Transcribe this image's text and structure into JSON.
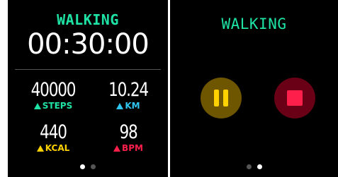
{
  "stats_screen": {
    "activity": "WALKING",
    "timer": "00:30:00",
    "stats": [
      {
        "value": "40000",
        "unit": "STEPS",
        "color": "#1fe3a5"
      },
      {
        "value": "10.24",
        "unit": "KM",
        "color": "#2ec5f0"
      },
      {
        "value": "440",
        "unit": "KCAL",
        "color": "#ffd200"
      },
      {
        "value": "98",
        "unit": "BPM",
        "color": "#ff1f4b"
      }
    ],
    "page_indicator": {
      "pages": 2,
      "active": 1
    }
  },
  "controls_screen": {
    "activity": "WALKING",
    "pause_icon": "pause-icon",
    "stop_icon": "stop-icon",
    "pause_color": "#ffd200",
    "stop_color": "#ff1f4b",
    "page_indicator": {
      "pages": 2,
      "active": 2
    }
  }
}
